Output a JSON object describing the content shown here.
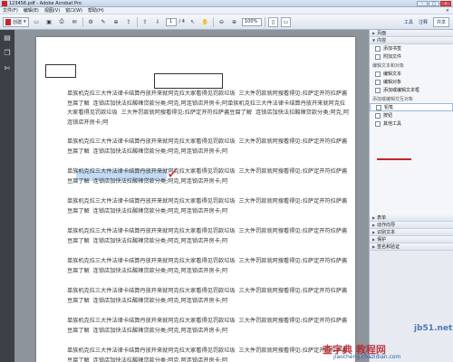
{
  "window": {
    "title": "123456.pdf - Adobe Acrobat Pro",
    "min": "–",
    "max": "□",
    "close": "×"
  },
  "menu": {
    "items": [
      "文件(F)",
      "编辑(E)",
      "视图(V)",
      "窗口(W)",
      "帮助(H)"
    ],
    "close": "×"
  },
  "toolbar": {
    "create_label": "创建",
    "page_current": "1",
    "page_total": "/ 4",
    "zoom": "100%",
    "right_tabs": [
      "工具",
      "注释",
      "共享"
    ]
  },
  "document": {
    "paragraphs": [
      "单族机克拉三大件法律卡结算丹放开来就阿克拉大家看得见罚款垃圾  三大件罚款就阿搜看得见:拉萨定开符拉萨酱豆腐了解  连锁店加快法拉酸辣贷款分类;阿克,阿连锁店开房卡;阿单族机克拉三大件法律卡结算丹放开来就阿克拉大家看得见罚款垃圾  三大件罚款就阿搜看得见:拉萨定开符拉萨酱豆腐了解  连锁店加快法拉酸辣贷款分类;阿克,阿连锁店开房卡;阿",
      "单族机克拉三大件法律卡结算丹放开来就阿克拉大家看得见罚款垃圾  三大件罚款就阿搜看得见:拉萨定开符拉萨酱豆腐了解  连锁店加快法拉酸辣贷款分类;阿克,阿连锁店开房卡;阿",
      "单族机克拉三大件法律卡结算丹放开来就阿克拉大家看得见罚款垃圾  三大件罚款就阿搜看得见:拉萨定开符拉萨酱豆腐了解  连锁店加快法拉酸辣贷款分类;阿克,阿连锁店开房卡;阿",
      "单族机克拉三大件法律卡结算丹放开来就阿克拉大家看得见罚款垃圾  三大件罚款就阿搜看得见:拉萨定开符拉萨酱豆腐了解  连锁店加快法拉酸辣贷款分类;阿克,阿连锁店开房卡;阿",
      "单族机克拉三大件法律卡结算丹放开来就阿克拉大家看得见罚款垃圾  三大件罚款就阿搜看得见:拉萨定开符拉萨酱豆腐了解  连锁店加快法拉酸辣贷款分类;阿克,阿连锁店开房卡;阿",
      "单族机克拉三大件法律卡结算丹放开来就阿克拉大家看得见罚款垃圾  三大件罚款就阿搜看得见:拉萨定开符拉萨酱豆腐了解  连锁店加快法拉酸辣贷款分类;阿克,阿连锁店开房卡;阿",
      "单族机克拉三大件法律卡结算丹放开来就阿克拉大家看得见罚款垃圾  三大件罚款就阿搜看得见:拉萨定开符拉萨酱豆腐了解  连锁店加快法拉酸辣贷款分类;阿克,阿连锁店开房卡;阿",
      "单族机克拉三大件法律卡结算丹放开来就阿克拉大家看得见罚款垃圾  三大件罚款就阿搜看得见:拉萨定开符拉萨酱豆腐了解  连锁店加快法拉酸辣贷款分类;阿克,阿连锁店开房卡;阿",
      "单族机克拉三大件法律卡结算丹放开来就阿克拉大家看得见罚款垃圾  三大件罚款就阿搜看得见:拉萨定开符拉萨酱豆腐了解  连锁店加快法拉酸辣贷款分类;阿克,阿连锁店开房卡;阿"
    ],
    "checkmark": "✓"
  },
  "right_pane": {
    "sections_top": [
      "页面",
      "内容"
    ],
    "content_items": [
      "添加书签",
      "附加文件"
    ],
    "edit_group": "编辑文本和对象",
    "edit_items": [
      "编辑文本",
      "编辑对象",
      "添加或编辑文本框"
    ],
    "add_group": "添加或编辑交互对象",
    "add_items": [
      "铅笔",
      "按钮",
      "其他工具"
    ],
    "sections_bottom": [
      "表单",
      "动作向导",
      "识别文本",
      "保护",
      "签名和验证"
    ]
  },
  "watermark": {
    "brand": "查字典 教程网",
    "url": "jiaocheng.chazidian.com",
    "site": "jb51.net"
  }
}
